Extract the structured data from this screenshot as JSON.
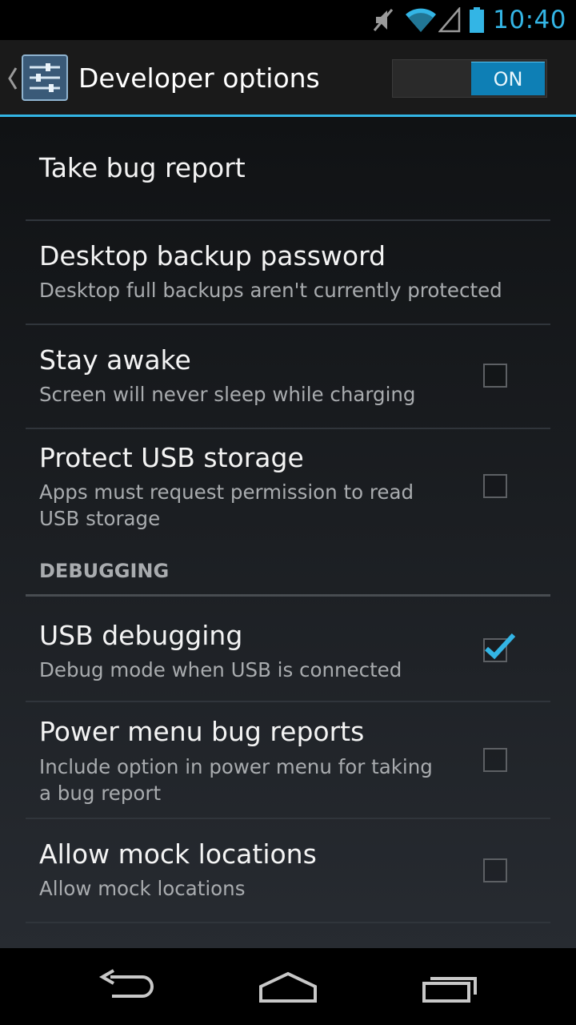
{
  "status_bar": {
    "time": "10:40",
    "icons": [
      "mute-icon",
      "wifi-icon",
      "signal-icon",
      "battery-icon"
    ],
    "accent": "#33b5e5"
  },
  "action_bar": {
    "title": "Developer options",
    "toggle": {
      "label": "ON",
      "state": "on"
    },
    "icons": [
      "back-caret-icon",
      "settings-sliders-icon"
    ]
  },
  "settings": {
    "rows": [
      {
        "title": "Take bug report",
        "subtitle": ""
      },
      {
        "title": "Desktop backup password",
        "subtitle": "Desktop full backups aren't currently protected"
      },
      {
        "title": "Stay awake",
        "subtitle": "Screen will never sleep while charging",
        "checked": false
      },
      {
        "title": "Protect USB storage",
        "subtitle_lines": [
          "Apps must request permission to read",
          "USB storage"
        ],
        "checked": false
      }
    ],
    "debugging_section": {
      "header": "DEBUGGING",
      "rows": [
        {
          "title": "USB debugging",
          "subtitle": "Debug mode when USB is connected",
          "checked": true
        },
        {
          "title": "Power menu bug reports",
          "subtitle_lines": [
            "Include option in power menu for taking",
            "a bug report"
          ],
          "checked": false
        },
        {
          "title": "Allow mock locations",
          "subtitle": "Allow mock locations",
          "checked": false
        }
      ]
    }
  },
  "nav_bar": {
    "buttons": [
      "back-icon",
      "home-icon",
      "recent-apps-icon"
    ]
  }
}
